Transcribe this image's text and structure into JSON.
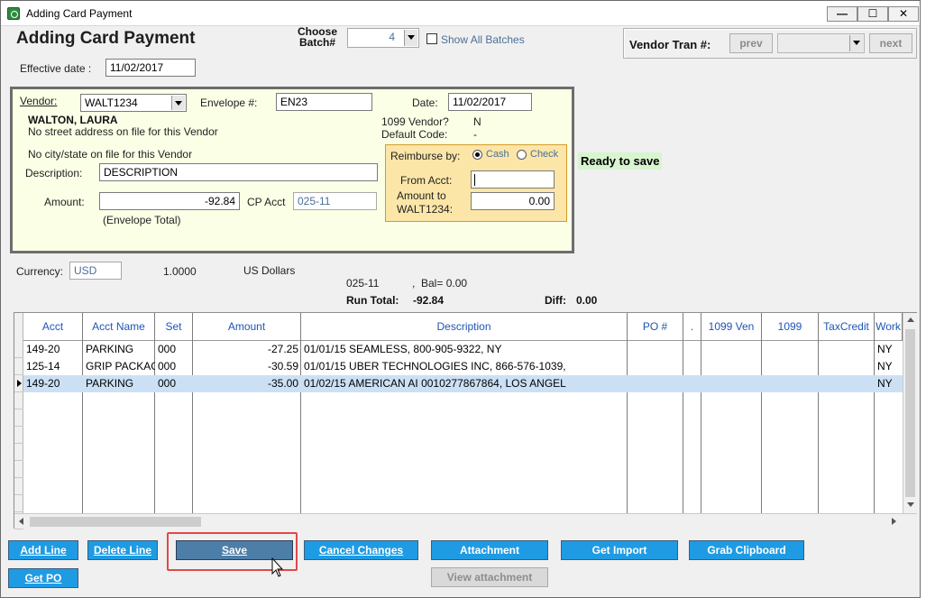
{
  "window": {
    "title": "Adding Card Payment",
    "minimize": "—",
    "maximize": "☐",
    "close": "✕"
  },
  "header": {
    "title": "Adding Card Payment",
    "choose_batch_label_line1": "Choose",
    "choose_batch_label_line2": "Batch#",
    "batch_value": "4",
    "show_all_batches_label": "Show All Batches",
    "show_all_batches_checked": false,
    "vendor_tran_label": "Vendor Tran #:",
    "prev_label": "prev",
    "next_label": "next",
    "vendor_tran_value": ""
  },
  "effective_date": {
    "label": "Effective date :",
    "value": "11/02/2017"
  },
  "vendor": {
    "vendor_label": "Vendor:",
    "vendor_value": "WALT1234",
    "envelope_label": "Envelope #:",
    "envelope_value": "EN23",
    "date_label": "Date:",
    "date_value": "11/02/2017",
    "vendor_name": "WALTON, LAURA",
    "address_line": "No street address on file for this Vendor",
    "city_line": "No city/state on file for this Vendor",
    "vendor_1099_label": "1099 Vendor?",
    "vendor_1099_value": "N",
    "default_code_label": "Default Code:",
    "default_code_value": "-",
    "description_label": "Description:",
    "description_value": "DESCRIPTION",
    "amount_label": "Amount:",
    "amount_value": "-92.84",
    "cp_acct_label": "CP Acct",
    "cp_acct_value": "025-11",
    "envelope_total_label": "(Envelope Total)"
  },
  "reimburse": {
    "label": "Reimburse by:",
    "cash_label": "Cash",
    "check_label": "Check",
    "selected": "Cash",
    "from_acct_label": "From Acct:",
    "from_acct_value": "",
    "amount_to_label_line1": "Amount to",
    "amount_to_label_line2": "WALT1234:",
    "amount_to_value": "0.00"
  },
  "status": {
    "ready": "Ready to save"
  },
  "currency": {
    "label": "Currency:",
    "code": "USD",
    "rate": "1.0000",
    "name": "US Dollars"
  },
  "totals": {
    "account": "025-11",
    "balance": ",  Bal= 0.00",
    "run_total_label": "Run Total:",
    "run_total_value": "-92.84",
    "diff_label": "Diff:",
    "diff_value": "0.00"
  },
  "grid": {
    "columns": [
      "Acct",
      "Acct Name",
      "Set",
      "Amount",
      "Description",
      "PO #",
      ".",
      "1099 Ven",
      "1099",
      "TaxCredit",
      "Work"
    ],
    "rows": [
      {
        "acct": "149-20",
        "acct_name": "PARKING",
        "set": "000",
        "amount": "-27.25",
        "description": "01/01/15 SEAMLESS, 800-905-9322, NY",
        "po": "",
        "dot": "",
        "ven1099": "",
        "f1099": "",
        "taxcredit": "",
        "work": "NY",
        "selected": false
      },
      {
        "acct": "125-14",
        "acct_name": "GRIP PACKAGE",
        "set": "000",
        "amount": "-30.59",
        "description": "01/01/15 UBER TECHNOLOGIES INC, 866-576-1039,",
        "po": "",
        "dot": "",
        "ven1099": "",
        "f1099": "",
        "taxcredit": "",
        "work": "NY",
        "selected": false
      },
      {
        "acct": "149-20",
        "acct_name": "PARKING",
        "set": "000",
        "amount": "-35.00",
        "description": "01/02/15 AMERICAN AI 0010277867864, LOS ANGEL",
        "po": "",
        "dot": "",
        "ven1099": "",
        "f1099": "",
        "taxcredit": "",
        "work": "NY",
        "selected": true
      }
    ]
  },
  "buttons": {
    "add_line": "Add Line",
    "delete_line": "Delete Line",
    "save": "Save",
    "cancel_changes": "Cancel Changes",
    "attachment": "Attachment",
    "get_import": "Get Import",
    "grab_clipboard": "Grab Clipboard",
    "get_po": "Get PO",
    "view_attachment": "View attachment"
  },
  "colors": {
    "button_blue": "#1f9be3",
    "save_button": "#4d7ea8",
    "vendor_panel": "#fbffe6",
    "reimburse_panel": "#fbe6a8",
    "ready_badge": "#d8f5d0",
    "selected_row": "#cce0f5",
    "column_header_text": "#1e56b4",
    "highlight_outline": "#e04848"
  }
}
